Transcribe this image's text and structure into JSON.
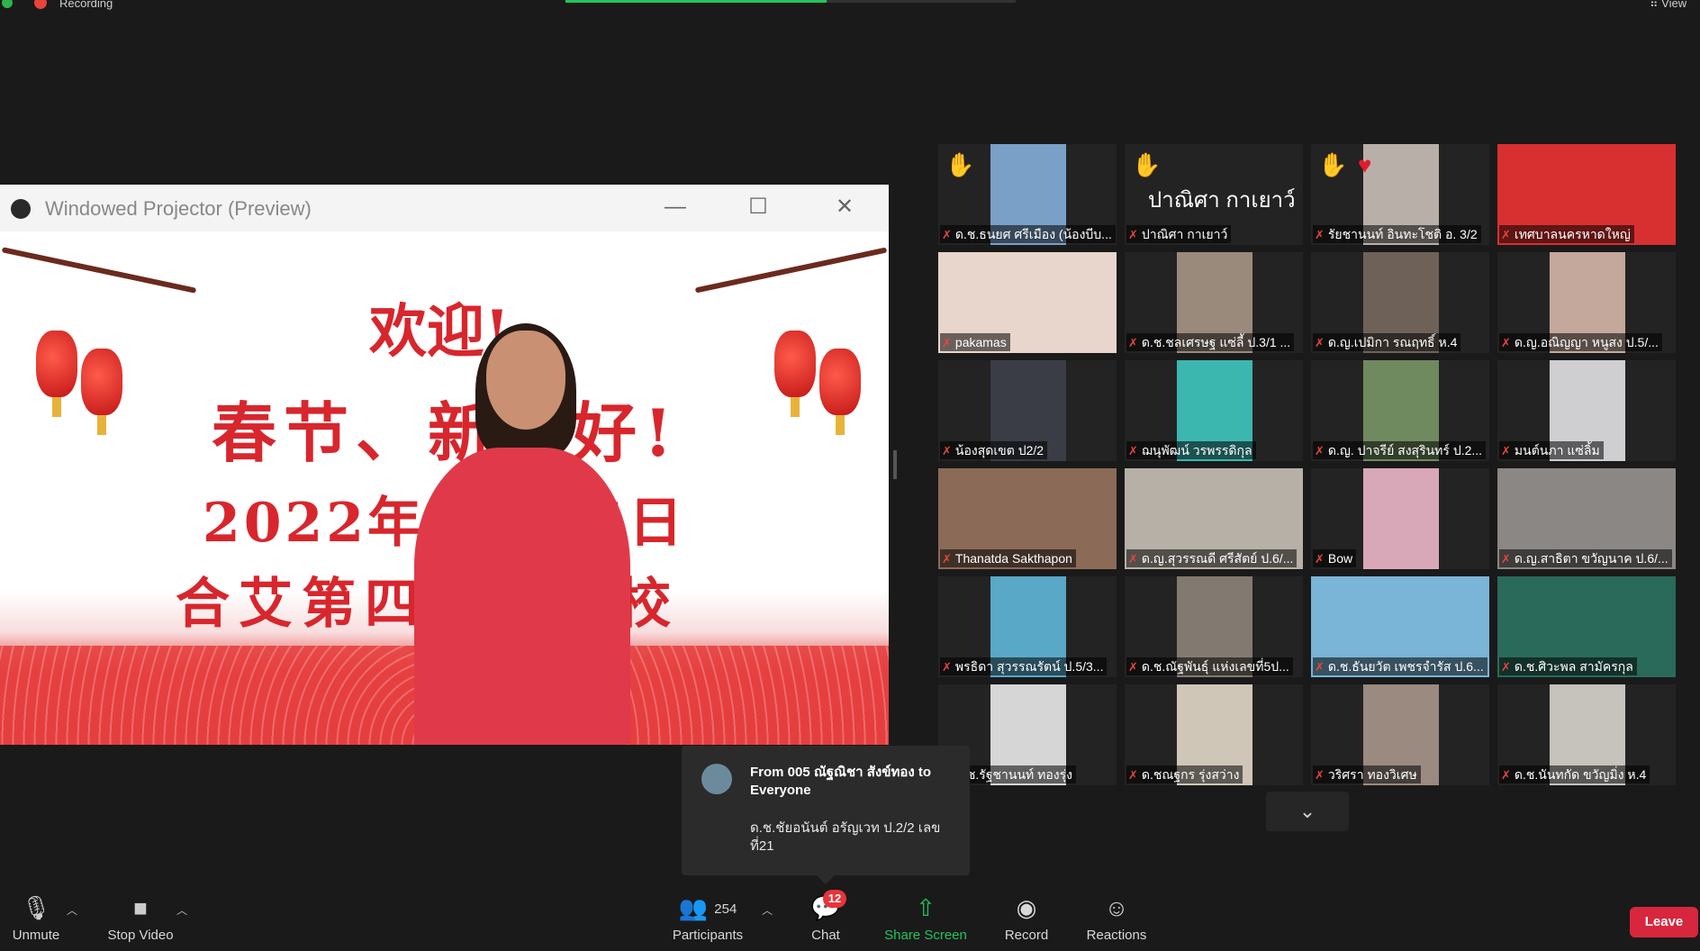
{
  "top_bar": {
    "recording_label": "Recording",
    "view_label": "View",
    "progress_fraction": 0.58,
    "colors": {
      "recording": "#e8443a",
      "progress": "#22c55e"
    }
  },
  "projector": {
    "window_title": "Windowed Projector (Preview)",
    "banner_lines": [
      "欢迎!",
      "春节、新年好!",
      "2022年 1月25日",
      "合艾第四公立学校"
    ]
  },
  "gallery": {
    "tiles": [
      {
        "name": "ด.ช.ธนยศ ศรีเมือง (น้องบีบ...",
        "raised_hand": true,
        "video": "#7aa0c8"
      },
      {
        "name": "ปาณิศา กาเยาว์",
        "raised_hand": true,
        "big_name": "ปาณิศา กาเยาว์"
      },
      {
        "name": "รัยชานนท์ อินทะโชติ อ. 3/2",
        "raised_hand": true,
        "reaction": "heart",
        "video": "#b8b0a8"
      },
      {
        "name": "เทศบาลนครหาดใหญ่",
        "video": "#d83030"
      },
      {
        "name": "pakamas",
        "video": "#e8d6cc"
      },
      {
        "name": "ด.ช.ชลเศรษฐ แซ่ลี้ ป.3/1 ...",
        "video": "#9a8a7c"
      },
      {
        "name": "ด.ญ.เปมิกา รณฤทธิ์ ห.4",
        "video": "#6e6258"
      },
      {
        "name": "ด.ญ.อณิญญา หนูสง ป.5/...",
        "video": "#c4a89c"
      },
      {
        "name": "น้องสุดเขต ป2/2",
        "video": "#3a3c46"
      },
      {
        "name": "ฌนุพัฒน์ วรพรรดิกุล",
        "video": "#3cb7b0"
      },
      {
        "name": "ด.ญ. ปาจรีย์ สงสุรินทร์ ป.2...",
        "video": "#6f8a5e"
      },
      {
        "name": "มนต์นภา แซ่ลิ้ม",
        "video": "#cfcfd2"
      },
      {
        "name": "Thanatda Sakthapon",
        "video": "#8c6a58"
      },
      {
        "name": "ด.ญ.สุวรรณดี ศรีสัตย์ ป.6/...",
        "video": "#b6b0a6"
      },
      {
        "name": "Bow",
        "video": "#d9a8b8"
      },
      {
        "name": "ด.ญ.สาธิตา ขวัญนาค ป.6/...",
        "video": "#8a8784"
      },
      {
        "name": "พรธิดา สุวรรณรัตน์ ป.5/3...",
        "video": "#5aa8c8"
      },
      {
        "name": "ด.ช.ณัฐพันธุ์ แห่งเลขที่5ป...",
        "video": "#827a70"
      },
      {
        "name": "ด.ช.ธันยวัต เพชรจำรัส ป.6...",
        "video": "#7ab4d6"
      },
      {
        "name": "ด.ช.ศิวะพล สามัครกุล",
        "video": "#2a6a5a"
      },
      {
        "name": "ด.ช.รัฐชานนท์ ทองรุ่ง",
        "video": "#d6d6d6"
      },
      {
        "name": "ด.ชณฐกร รุ่งสว่าง",
        "video": "#cfc6b8"
      },
      {
        "name": "วริศรา ทองวิเศษ",
        "video": "#9a8a80"
      },
      {
        "name": "ด.ช.นันทกัด ขวัญมิ่ง ห.4",
        "video": "#c6c2bc"
      }
    ]
  },
  "chat_popup": {
    "from": "From 005 ณัฐณิชา สังข์ทอง to Everyone",
    "message": "ด.ช.ชัยอนันต์ อรัญเวท ป.2/2 เลขที่21"
  },
  "toolbar": {
    "unmute": "Unmute",
    "stop_video": "Stop Video",
    "participants": "Participants",
    "participants_count": "254",
    "chat": "Chat",
    "chat_badge": "12",
    "share_screen": "Share Screen",
    "record": "Record",
    "reactions": "Reactions",
    "leave": "Leave",
    "colors": {
      "share": "#22c55e",
      "leave": "#d7263d"
    }
  }
}
